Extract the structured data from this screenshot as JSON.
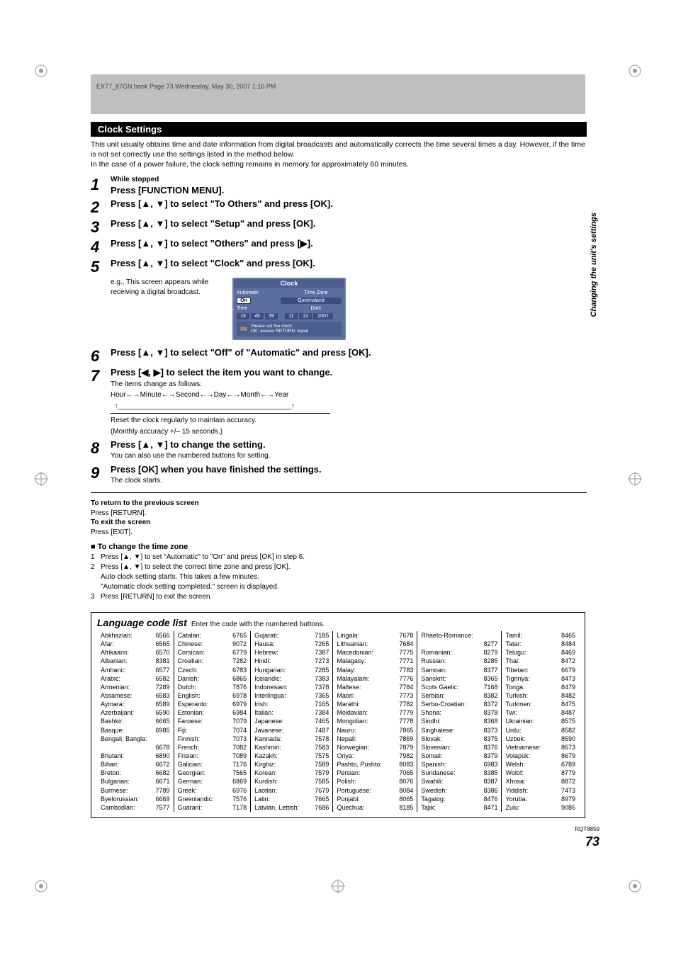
{
  "header_strip": "EX77_87GN.book   Page 73   Wednesday, May 30, 2007   1:10 PM",
  "section_title": "Clock Settings",
  "intro1": "This unit usually obtains time and date information from digital broadcasts and automatically corrects the time several times a day. However, if the time is not set correctly use the settings listed in the method below.",
  "intro2": "In the case of a power failure, the clock setting remains in memory for approximately 60 minutes.",
  "steps": {
    "1": {
      "pre": "While stopped",
      "main": "Press [FUNCTION MENU]."
    },
    "2": {
      "main": "Press [▲, ▼] to select \"To Others\" and press [OK]."
    },
    "3": {
      "main": "Press [▲, ▼] to select \"Setup\" and press [OK]."
    },
    "4": {
      "main": "Press [▲, ▼] to select \"Others\" and press [▶]."
    },
    "5": {
      "main": "Press [▲, ▼] to select \"Clock\" and press [OK]."
    },
    "5note": "e.g., This screen appears while receiving a digital broadcast.",
    "6": {
      "main": "Press [▲, ▼] to select \"Off\" of \"Automatic\" and press [OK]."
    },
    "7": {
      "main": "Press [◀, ▶] to select the item you want to change.",
      "sub1": "The items change as follows:",
      "sub2": "Hour←→Minute←→Second←→Day←→Month←→Year",
      "sub3": "Reset the clock regularly to maintain accuracy.",
      "sub4": "(Monthly accuracy +/– 15 seconds.)"
    },
    "8": {
      "main": "Press [▲, ▼] to change the setting.",
      "sub": "You can also use the numbered buttons for setting."
    },
    "9": {
      "main": "Press [OK] when you have finished the settings.",
      "sub": "The clock starts."
    }
  },
  "clock": {
    "title": "Clock",
    "automatic": "Automatic",
    "timezone_label": "Time Zone",
    "on": "On",
    "qld": "Queensland",
    "time_label": "Time",
    "date_label": "Date",
    "h": "15",
    "m": "45",
    "s": "39",
    "d": "11",
    "mo": "12",
    "y": "2007",
    "foot1": "Please set the clock.",
    "foot2": "OK: access   RETURN: leave"
  },
  "return_head": "To return to the previous screen",
  "return_body": "Press [RETURN].",
  "exit_head": "To exit the screen",
  "exit_body": "Press [EXIT].",
  "tz_head": "To change the time zone",
  "tz1": "Press [▲, ▼] to set \"Automatic\" to \"On\" and press [OK] in step 6.",
  "tz2a": "Press [▲, ▼] to select the correct time zone and press [OK].",
  "tz2b": "Auto clock setting starts. This takes a few minutes.",
  "tz2c": "\"Automatic clock setting completed.\" screen is displayed.",
  "tz3": "Press [RETURN] to exit the screen.",
  "lang_title": "Language code list",
  "lang_sub": "Enter the code with the numbered buttons.",
  "lang": {
    "c1": [
      [
        "Abkhazian:",
        "6566"
      ],
      [
        "Afar:",
        "6565"
      ],
      [
        "Afrikaans:",
        "6570"
      ],
      [
        "Albanian:",
        "8381"
      ],
      [
        "Amharic:",
        "6577"
      ],
      [
        "Arabic:",
        "6582"
      ],
      [
        "Armenian:",
        "7289"
      ],
      [
        "Assamese:",
        "6583"
      ],
      [
        "Aymara:",
        "6589"
      ],
      [
        "Azerbaijani:",
        "6590"
      ],
      [
        "Bashkir:",
        "6665"
      ],
      [
        "Basque:",
        "6985"
      ],
      [
        "Bengali; Bangla:",
        ""
      ],
      [
        "",
        "6678"
      ],
      [
        "Bhutani:",
        "6890"
      ],
      [
        "Bihari:",
        "6672"
      ],
      [
        "Breton:",
        "6682"
      ],
      [
        "Bulgarian:",
        "6671"
      ],
      [
        "Burmese:",
        "7789"
      ],
      [
        "Byelorussian:",
        "6669"
      ],
      [
        "Cambodian:",
        "7577"
      ]
    ],
    "c2": [
      [
        "Catalan:",
        "6765"
      ],
      [
        "Chinese:",
        "9072"
      ],
      [
        "Corsican:",
        "6779"
      ],
      [
        "Croatian:",
        "7282"
      ],
      [
        "Czech:",
        "6783"
      ],
      [
        "Danish:",
        "6865"
      ],
      [
        "Dutch:",
        "7876"
      ],
      [
        "English:",
        "6978"
      ],
      [
        "Esperanto:",
        "6979"
      ],
      [
        "Estonian:",
        "6984"
      ],
      [
        "Faroese:",
        "7079"
      ],
      [
        "Fiji:",
        "7074"
      ],
      [
        "Finnish:",
        "7073"
      ],
      [
        "French:",
        "7082"
      ],
      [
        "Frisian:",
        "7089"
      ],
      [
        "Galician:",
        "7176"
      ],
      [
        "Georgian:",
        "7565"
      ],
      [
        "German:",
        "6869"
      ],
      [
        "Greek:",
        "6976"
      ],
      [
        "Greenlandic:",
        "7576"
      ],
      [
        "Guarani:",
        "7178"
      ]
    ],
    "c3": [
      [
        "Gujarati:",
        "7185"
      ],
      [
        "Hausa:",
        "7265"
      ],
      [
        "Hebrew:",
        "7387"
      ],
      [
        "Hindi:",
        "7273"
      ],
      [
        "Hungarian:",
        "7285"
      ],
      [
        "Icelandic:",
        "7383"
      ],
      [
        "Indonesian:",
        "7378"
      ],
      [
        "Interlingua:",
        "7365"
      ],
      [
        "Irish:",
        "7165"
      ],
      [
        "Italian:",
        "7384"
      ],
      [
        "Japanese:",
        "7465"
      ],
      [
        "Javanese:",
        "7487"
      ],
      [
        "Kannada:",
        "7578"
      ],
      [
        "Kashmiri:",
        "7583"
      ],
      [
        "Kazakh:",
        "7575"
      ],
      [
        "Kirghiz:",
        "7589"
      ],
      [
        "Korean:",
        "7579"
      ],
      [
        "Kurdish:",
        "7585"
      ],
      [
        "Laotian:",
        "7679"
      ],
      [
        "Latin:",
        "7665"
      ],
      [
        "Latvian, Lettish:",
        "7686"
      ]
    ],
    "c4": [
      [
        "Lingala:",
        "7678"
      ],
      [
        "Lithuanian:",
        "7684"
      ],
      [
        "Macedonian:",
        "7775"
      ],
      [
        "Malagasy:",
        "7771"
      ],
      [
        "Malay:",
        "7783"
      ],
      [
        "Malayalam:",
        "7776"
      ],
      [
        "Maltese:",
        "7784"
      ],
      [
        "Maori:",
        "7773"
      ],
      [
        "Marathi:",
        "7782"
      ],
      [
        "Moldavian:",
        "7779"
      ],
      [
        "Mongolian:",
        "7778"
      ],
      [
        "Nauru:",
        "7865"
      ],
      [
        "Nepali:",
        "7869"
      ],
      [
        "Norwegian:",
        "7879"
      ],
      [
        "Oriya:",
        "7982"
      ],
      [
        "Pashto, Pushto:",
        "8083"
      ],
      [
        "Persian:",
        "7065"
      ],
      [
        "Polish:",
        "8076"
      ],
      [
        "Portuguese:",
        "8084"
      ],
      [
        "Punjabi:",
        "8065"
      ],
      [
        "Quechua:",
        "8185"
      ]
    ],
    "c5": [
      [
        "Rhaeto-Romance:",
        ""
      ],
      [
        "",
        "8277"
      ],
      [
        "Romanian:",
        "8279"
      ],
      [
        "Russian:",
        "8285"
      ],
      [
        "Samoan:",
        "8377"
      ],
      [
        "Sanskrit:",
        "8365"
      ],
      [
        "Scots Gaelic:",
        "7168"
      ],
      [
        "Serbian:",
        "8382"
      ],
      [
        "Serbo-Croatian:",
        "8372"
      ],
      [
        "Shona:",
        "8378"
      ],
      [
        "Sindhi:",
        "8368"
      ],
      [
        "Singhalese:",
        "8373"
      ],
      [
        "Slovak:",
        "8375"
      ],
      [
        "Slovenian:",
        "8376"
      ],
      [
        "Somali:",
        "8379"
      ],
      [
        "Spanish:",
        "6983"
      ],
      [
        "Sundanese:",
        "8385"
      ],
      [
        "Swahili:",
        "8387"
      ],
      [
        "Swedish:",
        "8386"
      ],
      [
        "Tagalog:",
        "8476"
      ],
      [
        "Tajik:",
        "8471"
      ]
    ],
    "c6": [
      [
        "Tamil:",
        "8465"
      ],
      [
        "Tatar:",
        "8484"
      ],
      [
        "Telugu:",
        "8469"
      ],
      [
        "Thai:",
        "8472"
      ],
      [
        "Tibetan:",
        "6679"
      ],
      [
        "Tigrinya:",
        "8473"
      ],
      [
        "Tonga:",
        "8479"
      ],
      [
        "Turkish:",
        "8482"
      ],
      [
        "Turkmen:",
        "8475"
      ],
      [
        "Twi:",
        "8487"
      ],
      [
        "Ukrainian:",
        "8575"
      ],
      [
        "Urdu:",
        "8582"
      ],
      [
        "Uzbek:",
        "8590"
      ],
      [
        "Vietnamese:",
        "8673"
      ],
      [
        "Volapük:",
        "8679"
      ],
      [
        "Welsh:",
        "6789"
      ],
      [
        "Wolof:",
        "8779"
      ],
      [
        "Xhosa:",
        "8872"
      ],
      [
        "Yiddish:",
        "7473"
      ],
      [
        "Yoruba:",
        "8979"
      ],
      [
        "Zulu:",
        "9085"
      ]
    ]
  },
  "side_text": "Changing the unit's settings",
  "page_num": "73",
  "rqt": "RQT8859"
}
